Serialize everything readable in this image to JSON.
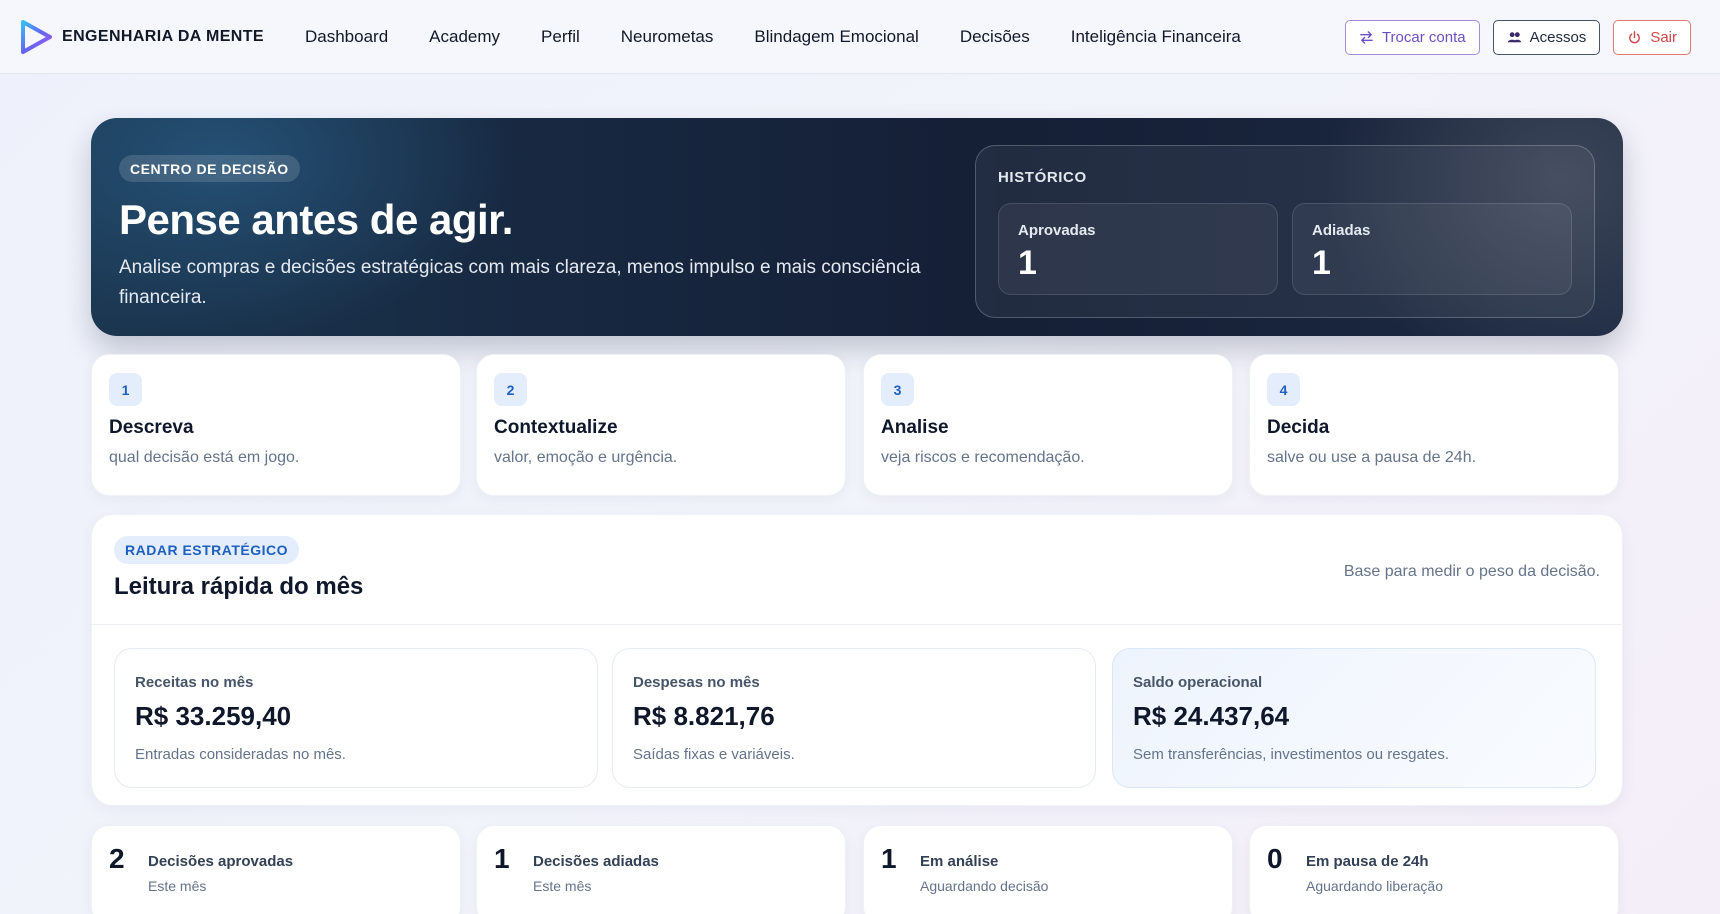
{
  "brand": {
    "name": "ENGENHARIA DA MENTE"
  },
  "nav": {
    "links": [
      "Dashboard",
      "Academy",
      "Perfil",
      "Neurometas",
      "Blindagem Emocional",
      "Decisões",
      "Inteligência Financeira"
    ],
    "actions": {
      "switch_account": "Trocar conta",
      "access": "Acessos",
      "logout": "Sair"
    }
  },
  "hero": {
    "badge": "CENTRO DE DECISÃO",
    "title": "Pense antes de agir.",
    "subtitle": "Analise compras e decisões estratégicas com mais clareza, menos impulso e mais consciência financeira.",
    "history": {
      "label": "HISTÓRICO",
      "approved_label": "Aprovadas",
      "approved_value": "1",
      "postponed_label": "Adiadas",
      "postponed_value": "1"
    }
  },
  "steps": [
    {
      "num": "1",
      "title": "Descreva",
      "desc": "qual decisão está em jogo."
    },
    {
      "num": "2",
      "title": "Contextualize",
      "desc": "valor, emoção e urgência."
    },
    {
      "num": "3",
      "title": "Analise",
      "desc": "veja riscos e recomendação."
    },
    {
      "num": "4",
      "title": "Decida",
      "desc": "salve ou use a pausa de 24h."
    }
  ],
  "radar": {
    "badge": "RADAR ESTRATÉGICO",
    "title": "Leitura rápida do mês",
    "note": "Base para medir o peso da decisão.",
    "metrics": [
      {
        "label": "Receitas no mês",
        "value": "R$ 33.259,40",
        "desc": "Entradas consideradas no mês."
      },
      {
        "label": "Despesas no mês",
        "value": "R$ 8.821,76",
        "desc": "Saídas fixas e variáveis."
      },
      {
        "label": "Saldo operacional",
        "value": "R$ 24.437,64",
        "desc": "Sem transferências, investimentos ou resgates."
      }
    ]
  },
  "stats": [
    {
      "num": "2",
      "label": "Decisões aprovadas",
      "sub": "Este mês"
    },
    {
      "num": "1",
      "label": "Decisões adiadas",
      "sub": "Este mês"
    },
    {
      "num": "1",
      "label": "Em análise",
      "sub": "Aguardando decisão"
    },
    {
      "num": "0",
      "label": "Em pausa de 24h",
      "sub": "Aguardando liberação"
    }
  ],
  "colors": {
    "hero_bg": "#151f36",
    "accent_blue": "#1e5fbf",
    "accent_purple": "#6d4fc2",
    "danger": "#d24848"
  },
  "icons": [
    "play-logo-icon",
    "swap-icon",
    "users-icon",
    "power-icon"
  ]
}
